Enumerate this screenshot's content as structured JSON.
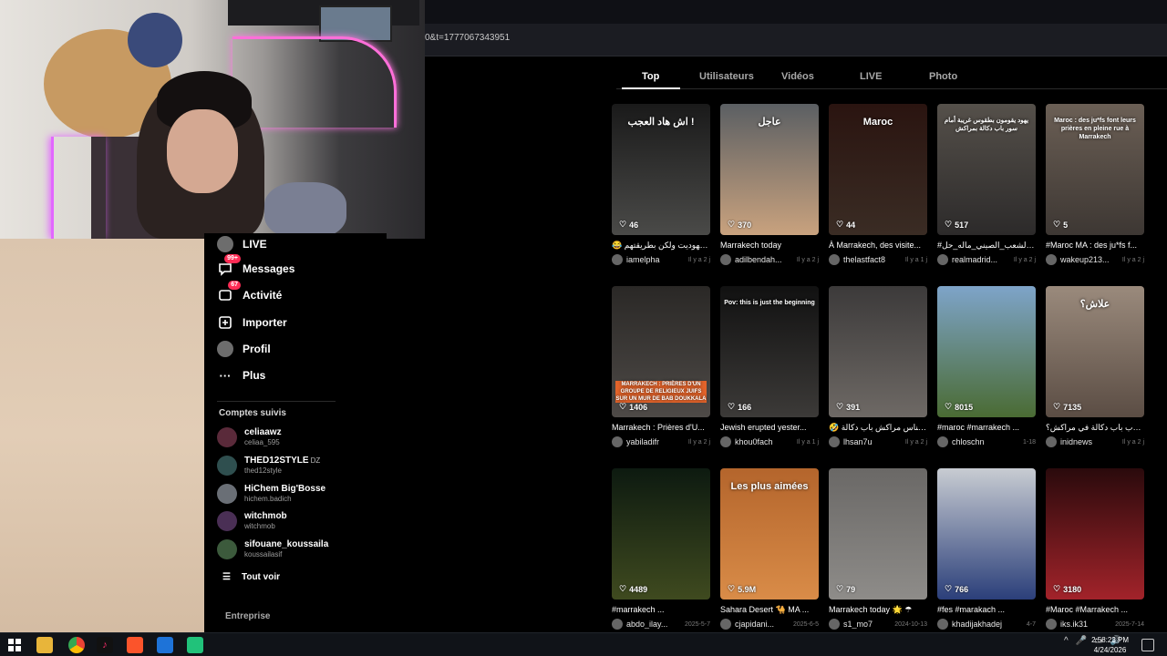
{
  "browser": {
    "url_fragment": "0&t=1777067343951"
  },
  "sidebar": {
    "nav": [
      {
        "label": "LIVE",
        "icon": "live-icon"
      },
      {
        "label": "Messages",
        "icon": "messages-icon",
        "badge": "99+"
      },
      {
        "label": "Activité",
        "icon": "activity-icon",
        "badge": "67"
      },
      {
        "label": "Importer",
        "icon": "upload-icon"
      },
      {
        "label": "Profil",
        "icon": "profile-icon"
      },
      {
        "label": "Plus",
        "icon": "more-icon"
      }
    ],
    "following_title": "Comptes suivis",
    "accounts": [
      {
        "name": "celiaawz",
        "handle": "celiaa_595",
        "tag": ""
      },
      {
        "name": "THED12STYLE",
        "handle": "thed12style",
        "tag": "DZ"
      },
      {
        "name": "HiChem Big'Bosse",
        "handle": "hichem.badich",
        "tag": ""
      },
      {
        "name": "witchmob",
        "handle": "witchmob",
        "tag": ""
      },
      {
        "name": "sifouane_koussaila",
        "handle": "koussailasif",
        "tag": ""
      }
    ],
    "see_all": "Tout voir",
    "business": "Entreprise"
  },
  "tabs": [
    "Top",
    "Utilisateurs",
    "Vidéos",
    "LIVE",
    "Photo"
  ],
  "videos": [
    {
      "likes": "46",
      "caption": "😂 سن أيهوديت ولكن بطريقتهم",
      "user": "iamelpha",
      "date": "Il y a 2 j",
      "overlay": "اش هاد العجب !",
      "colors": [
        "#1a1a1a",
        "#4a4a48"
      ]
    },
    {
      "likes": "370",
      "caption": "Marrakech today",
      "user": "adilbendah...",
      "date": "Il y a 2 j",
      "overlay": "عاجل",
      "colors": [
        "#5b5f63",
        "#c9a27e"
      ]
    },
    {
      "likes": "44",
      "caption": "À Marrakech, des visite...",
      "user": "thelastfact8",
      "date": "Il y a 1 j",
      "overlay": "Maroc",
      "colors": [
        "#2a1410",
        "#3a2c24"
      ]
    },
    {
      "likes": "517",
      "caption": "#الشعب_الصيني_ماله_حل 😂😂",
      "user": "realmadrid...",
      "date": "Il y a 2 j",
      "overlay": "يهود يقومون بطقوس غريبة أمام سور باب دكالة بمراكش",
      "colors": [
        "#55504a",
        "#2c2a2a"
      ]
    },
    {
      "likes": "5",
      "caption": "#Maroc MA : des ju*fs f...",
      "user": "wakeup213...",
      "date": "Il y a 2 j",
      "overlay": "Maroc : des ju*fs font leurs prières en pleine rue à Marrakech",
      "colors": [
        "#6b5f55",
        "#3d3733"
      ]
    },
    {
      "likes": "1406",
      "caption": "Marrakech : Prières d'U...",
      "user": "yabiladifr",
      "date": "Il y a 2 j",
      "overlay": "MARRAKECH : PRIÈRES D'UN GROUPE DE RELIGIEUX JUIFS SUR UN MUR DE BAB DOUKKALA",
      "colors": [
        "#2a2826",
        "#4e4a47"
      ]
    },
    {
      "likes": "166",
      "caption": "Jewish erupted yester...",
      "user": "khou0fach",
      "date": "Il y a 1 j",
      "overlay": "Pov: this is just the beginning",
      "colors": [
        "#111",
        "#3c3a38"
      ]
    },
    {
      "likes": "391",
      "caption": "🤣 حجة لناس مراكش باب دكالة",
      "user": "lhsan7u",
      "date": "Il y a 2 j",
      "overlay": "",
      "colors": [
        "#3c3a3a",
        "#6e6965"
      ]
    },
    {
      "likes": "8015",
      "caption": "#maroc #marrakech ...",
      "user": "chloschn",
      "date": "1-18",
      "overlay": "",
      "colors": [
        "#7ea4c9",
        "#4a6b33"
      ]
    },
    {
      "likes": "7135",
      "caption": "يهود قرب باب دكالة في مراكش؟",
      "user": "inidnews",
      "date": "Il y a 2 j",
      "overlay": "علاش؟",
      "colors": [
        "#9a8a7c",
        "#5b4d44"
      ]
    },
    {
      "likes": "4489",
      "caption": "#marrakech ...",
      "user": "abdo_ilay...",
      "date": "2025-5-7",
      "overlay": "",
      "colors": [
        "#0d1a10",
        "#3f4a1f"
      ]
    },
    {
      "likes": "5.9M",
      "caption": "Sahara Desert 🐪 MA ...",
      "user": "cjapidani...",
      "date": "2025-6-5",
      "overlay": "Les plus aimées",
      "colors": [
        "#b4652c",
        "#d98c48"
      ]
    },
    {
      "likes": "79",
      "caption": "Marrakech today 🌟 ☂",
      "user": "s1_mo7",
      "date": "2024-10-13",
      "overlay": "",
      "colors": [
        "#6a6866",
        "#8e8c89"
      ]
    },
    {
      "likes": "766",
      "caption": "#fes #marakach ...",
      "user": "khadijakhadej",
      "date": "4-7",
      "overlay": "",
      "colors": [
        "#c8ccd2",
        "#2b3f7a"
      ]
    },
    {
      "likes": "3180",
      "caption": "#Maroc #Marrakech ...",
      "user": "iks.ik31",
      "date": "2025-7-14",
      "overlay": "",
      "colors": [
        "#2a0a0c",
        "#a2232a"
      ]
    }
  ],
  "taskbar": {
    "apps": [
      "start-icon",
      "file-explorer-icon",
      "chrome-icon",
      "tiktok-icon",
      "brave-icon",
      "edge-icon",
      "app-icon"
    ],
    "time": "2:58:23 PM",
    "date": "4/24/2026"
  }
}
